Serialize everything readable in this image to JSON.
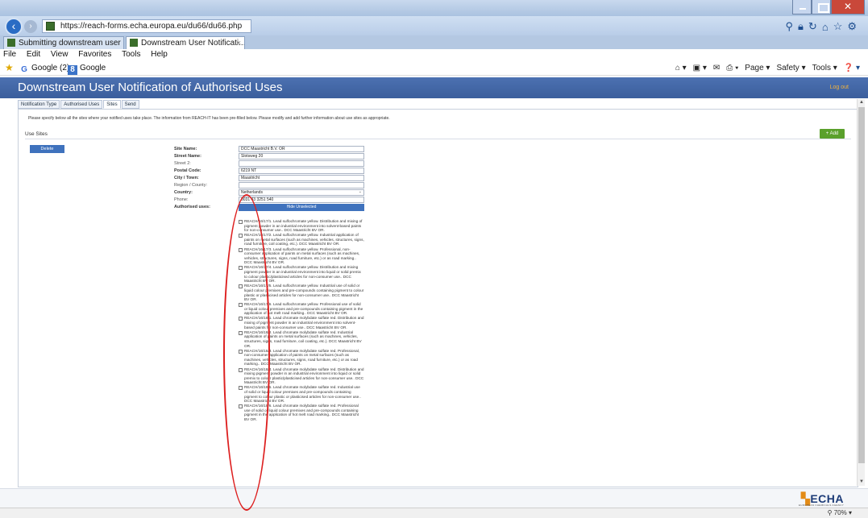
{
  "browser": {
    "url": "https://reach-forms.echa.europa.eu/du66/du66.php",
    "tabs": [
      {
        "label": "Submitting downstream user n..."
      },
      {
        "label": "Downstream User Notificati...",
        "close": "×"
      }
    ],
    "menu": [
      "File",
      "Edit",
      "View",
      "Favorites",
      "Tools",
      "Help"
    ],
    "favorites": [
      "Google (2)",
      "Google"
    ],
    "commands": [
      "Page ▾",
      "Safety ▾",
      "Tools ▾"
    ],
    "zoom": "70%"
  },
  "app": {
    "title": "Downstream User Notification of Authorised Uses",
    "logout": "Log out",
    "tabs": [
      "Notification Type",
      "Authorised Uses",
      "Sites",
      "Send"
    ],
    "instructions": "Please specify below all the sites where your notified uses take place. The information from REACH-IT has been pre-filled below. Please modify and add further information about use sites as appropriate.",
    "section_title": "Use Sites",
    "add_label": "+ Add",
    "delete_label": "Delete",
    "hide_label": "Hide Unselected"
  },
  "site": {
    "labels": {
      "name": "Site Name:",
      "street": "Street Name:",
      "street2": "Street 2:",
      "postal": "Postal Code:",
      "city": "City / Town:",
      "region": "Region / County:",
      "country": "Country:",
      "phone": "Phone:",
      "uses": "Authorised uses:"
    },
    "values": {
      "name": "DCC Maastricht B.V. OR",
      "street": "Slotsweg 20",
      "street2": "",
      "postal": "6219 NT",
      "city": "Maastricht",
      "region": "",
      "country": "Netherlands",
      "phone": "0031 43 3251 540"
    }
  },
  "uses": [
    "REACH/16/17/1. Lead sulfochromate yellow. Distribution and mixing of pigment powder in an industrial environment into solvent-based paints for non-consumer use.. DCC Maastricht BV OR.",
    "REACH/16/17/2. Lead sulfochromate yellow. Industrial application of paints on metal surfaces (such as machines, vehicles, structures, signs, road furniture, coil coating, etc.). DCC Maastricht BV OR.",
    "REACH/16/17/3. Lead sulfochromate yellow. Professional, non-consumer application of paints on metal surfaces (such as machines, vehicles, structures, signs, road furniture, etc.) or as road marking.. DCC Maastricht BV OR.",
    "REACH/16/17/4. Lead sulfochromate yellow. Distribution and mixing pigment powder in an industrial environment into liquid or solid premix to colour plastic/plasticised articles for non-consumer use.. DCC Maastricht BV OR.",
    "REACH/16/17/5. Lead sulfochromate yellow. Industrial use of solid or liquid colour premixes and pre-compounds containing pigment to colour plastic or plasticised articles for non-consumer use.. DCC Maastricht BV OR.",
    "REACH/16/17/6. Lead sulfochromate yellow. Professional use of solid or liquid colour premixes and pre-compounds containing pigment in the application of hot melt road marking.. DCC Maastricht BV OR.",
    "REACH/16/18/1. Lead chromate molybdate sulfate red. Distribution and mixing of pigment powder in an industrial environment into solvent-based paints for non-consumer use.. DCC Maastricht BV OR.",
    "REACH/16/18/2. Lead chromate molybdate sulfate red. Industrial application of paints on metal surfaces (such as machines, vehicles, structures, signs, road furniture, coil coating, etc.). DCC Maastricht BV OR.",
    "REACH/16/18/3. Lead chromate molybdate sulfate red. Professional, non-consumer application of paints on metal surfaces (such as machines, vehicles, structures, signs, road furniture, etc.) or as road marking.. DCC Maastricht BV OR.",
    "REACH/16/18/4. Lead chromate molybdate sulfate red. Distribution and mixing pigment powder in an industrial environment into liquid or solid premix to colour plastic/plasticised articles for non-consumer use.. DCC Maastricht BV OR.",
    "REACH/16/18/5. Lead chromate molybdate sulfate red. Industrial use of solid or liquid colour premixes and pre-compounds containing pigment to colour plastic or plasticised articles for non-consumer use.. DCC Maastricht BV OR.",
    "REACH/16/18/6. Lead chromate molybdate sulfate red. Professional use of solid or liquid colour premixes and pre-compounds containing pigment in the application of hot melt road marking.. DCC Maastricht BV OR."
  ],
  "footer": {
    "logo": "ECHA",
    "logo_sub": "EUROPEAN CHEMICALS AGENCY"
  }
}
